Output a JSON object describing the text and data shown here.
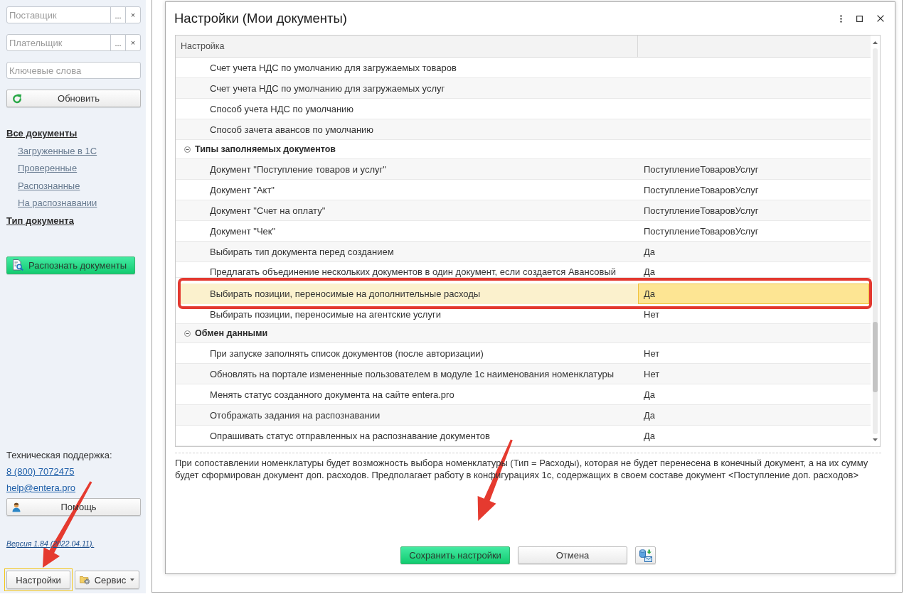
{
  "sidebar": {
    "filters": [
      {
        "placeholder": "Поставщик",
        "select_button": "...",
        "clear_button": "×"
      },
      {
        "placeholder": "Плательщик",
        "select_button": "...",
        "clear_button": "×"
      },
      {
        "placeholder": "Ключевые слова"
      }
    ],
    "refresh_button": "Обновить",
    "nav": [
      {
        "label": "Все документы",
        "children": [
          {
            "label": "Загруженные в 1С"
          },
          {
            "label": "Проверенные"
          },
          {
            "label": "Распознанные"
          },
          {
            "label": "На распознавании"
          }
        ]
      },
      {
        "label": "Тип документа"
      }
    ],
    "recognize_button": "Распознать документы",
    "support": {
      "title": "Техническая поддержка:",
      "phone": "8 (800) 7072475",
      "email": "help@entera.pro"
    },
    "help_button": "Помощь",
    "version": "Версия 1.84 (2022.04.11).",
    "footer_buttons": [
      {
        "kind": "plain",
        "label": "Настройки",
        "focused": true,
        "arrow": true
      },
      {
        "kind": "menu",
        "label": "Сервис",
        "focused": false,
        "arrow": false
      }
    ]
  },
  "dialog": {
    "title": "Настройки (Мои документы)",
    "table": {
      "columns": [
        "Настройка"
      ],
      "groups": [
        {
          "children": [
            {
              "name": "Счет учета НДС по умолчанию для загружаемых товаров",
              "selected": false,
              "outlined": false
            },
            {
              "name": "Счет учета НДС по умолчанию для загружаемых услуг",
              "selected": false,
              "outlined": false
            },
            {
              "name": "Способ учета НДС по умолчанию",
              "selected": false,
              "outlined": false
            },
            {
              "name": "Способ зачета авансов по умолчанию",
              "selected": false,
              "outlined": false
            }
          ]
        },
        {
          "name": "Типы заполняемых документов",
          "expanded": true,
          "children": [
            {
              "name": "Документ \"Поступление товаров и услуг\"",
              "value": "ПоступлениеТоваровУслуг",
              "selected": false,
              "outlined": false
            },
            {
              "name": "Документ \"Акт\"",
              "value": "ПоступлениеТоваровУслуг",
              "selected": false,
              "outlined": false
            },
            {
              "name": "Документ \"Счет на оплату\"",
              "value": "ПоступлениеТоваровУслуг",
              "selected": false,
              "outlined": false
            },
            {
              "name": "Документ \"Чек\"",
              "value": "ПоступлениеТоваровУслуг",
              "selected": false,
              "outlined": false
            },
            {
              "name": "Выбирать тип документа перед созданием",
              "value": "Да",
              "selected": false,
              "outlined": false
            },
            {
              "name": "Предлагать объединение нескольких документов в один документ, если создается Авансовый",
              "value": "Да",
              "selected": false,
              "outlined": false
            },
            {
              "name": "Выбирать позиции, переносимые на дополнительные расходы",
              "value": "Да",
              "selected": true,
              "outlined": true
            },
            {
              "name": "Выбирать позиции, переносимые на агентские услуги",
              "value": "Нет",
              "selected": false,
              "outlined": false
            }
          ]
        },
        {
          "name": "Обмен данными",
          "expanded": true,
          "children": [
            {
              "name": "При запуске заполнять список документов (после авторизации)",
              "value": "Нет",
              "selected": false,
              "outlined": false
            },
            {
              "name": "Обновлять на портале измененные пользователем в модуле 1с наименования номенклатуры",
              "value": "Нет",
              "selected": false,
              "outlined": false
            },
            {
              "name": "Менять статус созданного документа на сайте entera.pro",
              "value": "Да",
              "selected": false,
              "outlined": false
            },
            {
              "name": "Отображать задания на распознавании",
              "value": "Да",
              "selected": false,
              "outlined": false
            },
            {
              "name": "Опрашивать статус отправленных на распознавание документов",
              "value": "Да",
              "selected": false,
              "outlined": false
            }
          ]
        }
      ]
    },
    "description": "При сопоставлении номенклатуры будет возможность выбора номенклатуры (Тип = Расходы), которая не будет перенесена в конечный документ, а на их сумму будет сформирован документ доп. расходов. Предполагает работу в конфигурациях 1с, содержащих в своем составе документ <Поступление доп. расходов>",
    "buttons": [
      {
        "kind": "primary",
        "label": "Сохранить настройки",
        "arrow": true
      },
      {
        "kind": "plain",
        "label": "Отмена",
        "arrow": false
      },
      {
        "kind": "icon",
        "arrow": false
      }
    ]
  }
}
